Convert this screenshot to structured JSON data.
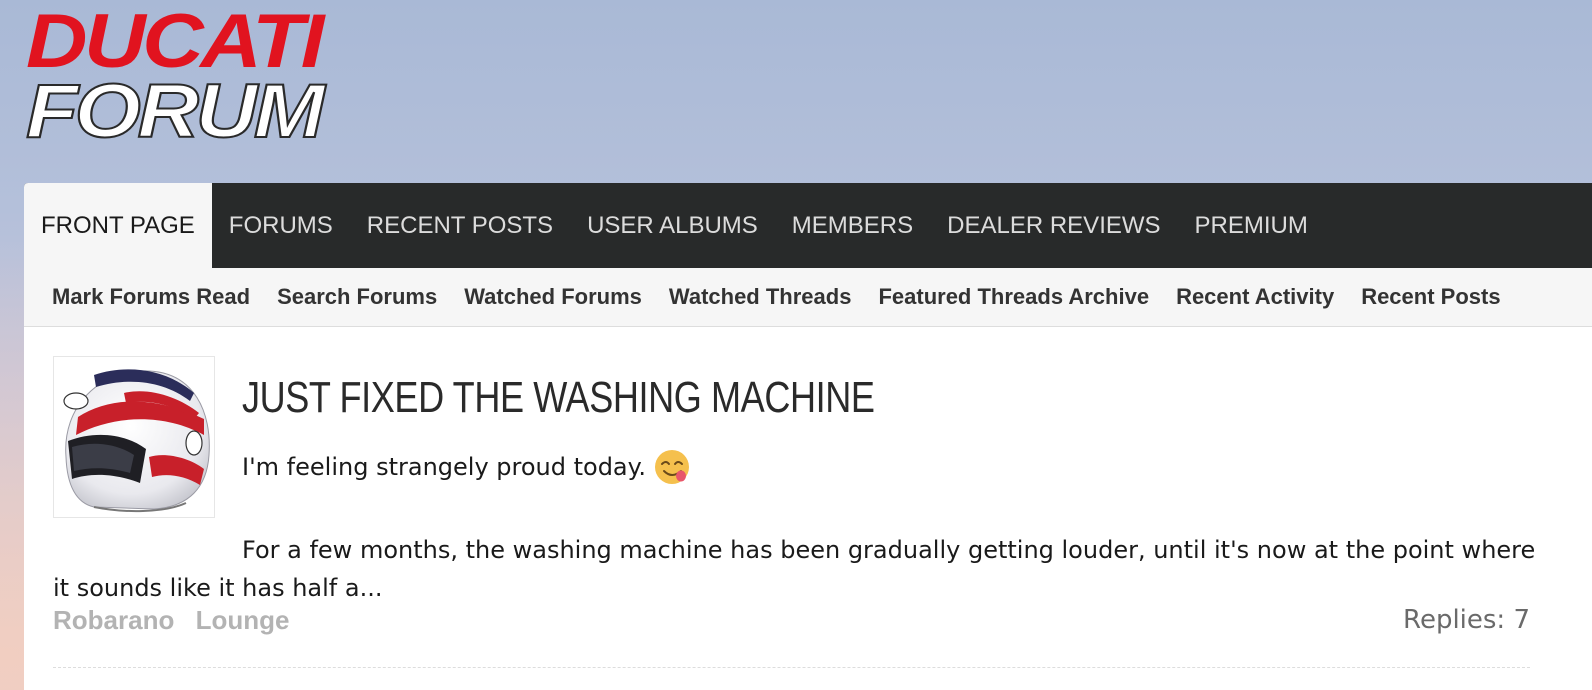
{
  "logo": {
    "line1": "DUCATI",
    "line2": "FORUM"
  },
  "nav": {
    "tabs": [
      {
        "label": "FRONT PAGE",
        "active": true
      },
      {
        "label": "FORUMS",
        "active": false
      },
      {
        "label": "RECENT POSTS",
        "active": false
      },
      {
        "label": "USER ALBUMS",
        "active": false
      },
      {
        "label": "MEMBERS",
        "active": false
      },
      {
        "label": "DEALER REVIEWS",
        "active": false
      },
      {
        "label": "PREMIUM",
        "active": false
      }
    ]
  },
  "subnav": {
    "items": [
      {
        "label": "Mark Forums Read"
      },
      {
        "label": "Search Forums"
      },
      {
        "label": "Watched Forums"
      },
      {
        "label": "Watched Threads"
      },
      {
        "label": "Featured Threads Archive"
      },
      {
        "label": "Recent Activity"
      },
      {
        "label": "Recent Posts"
      }
    ]
  },
  "thread": {
    "title": "JUST FIXED THE WASHING MACHINE",
    "tagline": "I'm feeling strangely proud today.",
    "emoji": "face-savoring-food-icon",
    "excerpt": "For a few months, the washing machine has been gradually getting louder, until it's now at the point where it sounds like it has half a...",
    "author": "Robarano",
    "forum": "Lounge",
    "replies": "Replies: 7"
  },
  "colors": {
    "brand_red": "#e1131f",
    "nav_bg": "#282a2a",
    "subnav_bg": "#f6f6f6",
    "meta_text": "#b3b3b3"
  }
}
